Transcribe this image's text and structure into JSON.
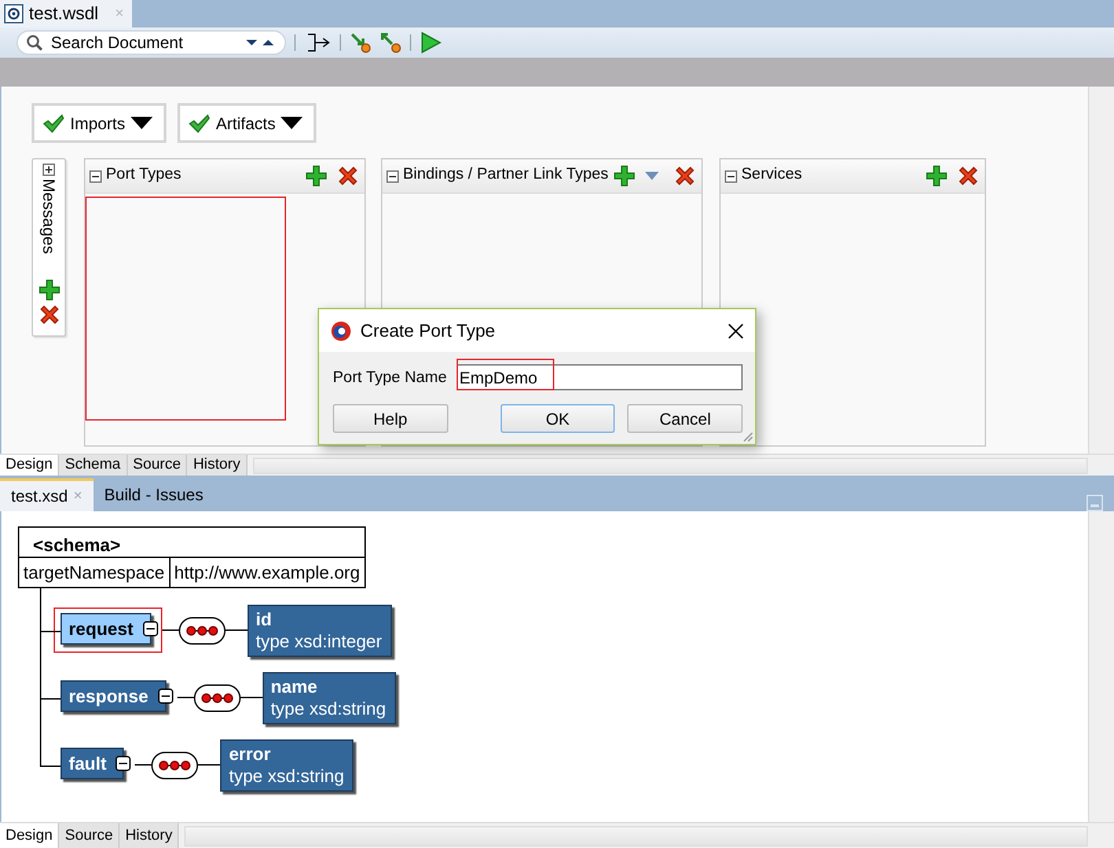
{
  "editor_tab": {
    "title": "test.wsdl",
    "close": "×",
    "selected": true
  },
  "toolbar": {
    "search": {
      "placeholder": "Search Document"
    }
  },
  "artifact_buttons": [
    {
      "label": "Imports",
      "checked": true
    },
    {
      "label": "Artifacts",
      "checked": true
    }
  ],
  "messages": {
    "label": "Messages",
    "expanded": false
  },
  "panels": [
    {
      "title": "Port Types",
      "expanded": true,
      "has_menu": false,
      "highlighted": true
    },
    {
      "title": "Bindings / Partner Link Types",
      "expanded": true,
      "has_menu": true,
      "highlighted": false
    },
    {
      "title": "Services",
      "expanded": true,
      "has_menu": false,
      "highlighted": false
    }
  ],
  "dialog": {
    "title": "Create Port Type",
    "field": {
      "label": "Port Type Name",
      "value": "EmpDemo",
      "highlighted": true
    },
    "buttons": [
      {
        "label": "Help",
        "default": false
      },
      {
        "label": "OK",
        "default": true
      },
      {
        "label": "Cancel",
        "default": false
      }
    ]
  },
  "editor_views": [
    {
      "label": "Design",
      "selected": true
    },
    {
      "label": "Schema",
      "selected": false
    },
    {
      "label": "Source",
      "selected": false
    },
    {
      "label": "History",
      "selected": false
    }
  ],
  "bottom_tabs": [
    {
      "label": "test.xsd",
      "selected": true,
      "close": "×"
    },
    {
      "label": "Build - Issues",
      "selected": false
    }
  ],
  "schema": {
    "title": "<schema>",
    "attributes": [
      {
        "name": "targetNamespace",
        "value": "http://www.example.org"
      }
    ],
    "elements": [
      {
        "name": "request",
        "selected": true,
        "child": {
          "name": "id",
          "type": "type xsd:integer"
        }
      },
      {
        "name": "response",
        "selected": false,
        "child": {
          "name": "name",
          "type": "type xsd:string"
        }
      },
      {
        "name": "fault",
        "selected": false,
        "child": {
          "name": "error",
          "type": "type xsd:string"
        }
      }
    ]
  },
  "schema_views": [
    {
      "label": "Design",
      "selected": true
    },
    {
      "label": "Source",
      "selected": false
    },
    {
      "label": "History",
      "selected": false
    }
  ]
}
